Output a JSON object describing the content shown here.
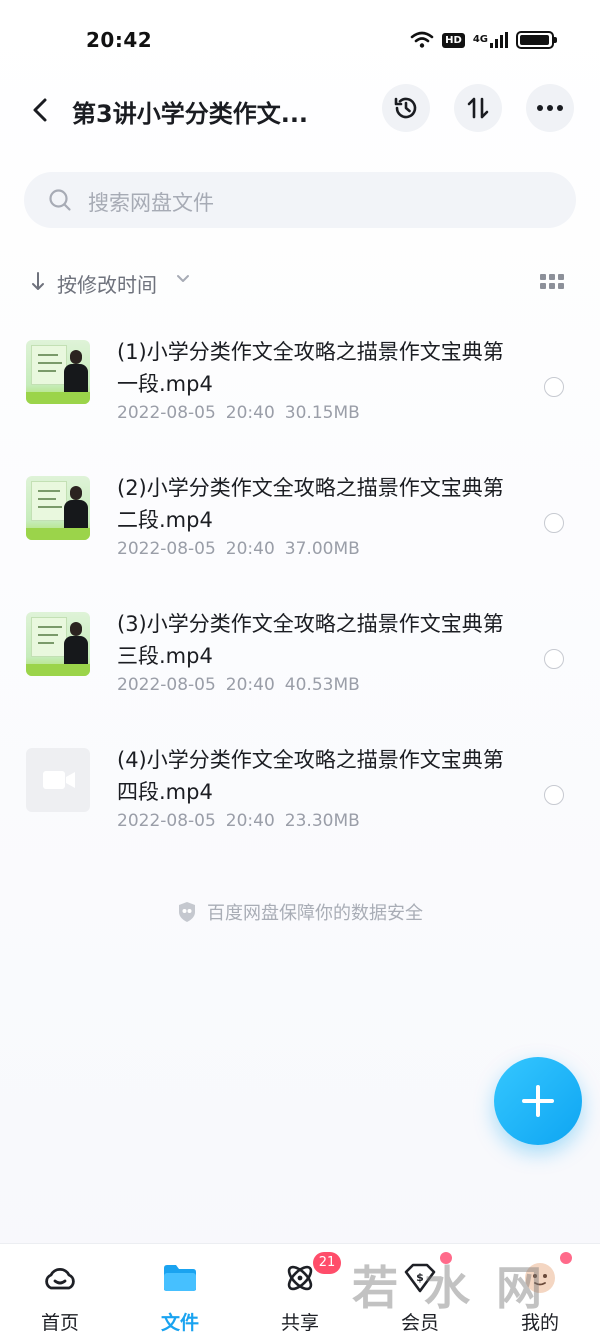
{
  "status_bar": {
    "time": "20:42",
    "hd": "HD",
    "network": "4G",
    "battery_level": 0.95
  },
  "header": {
    "title": "第3讲小学分类作文...",
    "back_icon": "chevron-left-icon",
    "actions": [
      "history-icon",
      "sort-icon",
      "more-icon"
    ]
  },
  "search": {
    "placeholder": "搜索网盘文件"
  },
  "sort": {
    "label": "按修改时间"
  },
  "files": [
    {
      "name": "(1)小学分类作文全攻略之描景作文宝典第一段.mp4",
      "date": "2022-08-05",
      "time": "20:40",
      "size": "30.15MB",
      "thumb": "video-thumbnail"
    },
    {
      "name": "(2)小学分类作文全攻略之描景作文宝典第二段.mp4",
      "date": "2022-08-05",
      "time": "20:40",
      "size": "37.00MB",
      "thumb": "video-thumbnail"
    },
    {
      "name": "(3)小学分类作文全攻略之描景作文宝典第三段.mp4",
      "date": "2022-08-05",
      "time": "20:40",
      "size": "40.53MB",
      "thumb": "video-thumbnail"
    },
    {
      "name": "(4)小学分类作文全攻略之描景作文宝典第四段.mp4",
      "date": "2022-08-05",
      "time": "20:40",
      "size": "23.30MB",
      "thumb": "video-placeholder"
    }
  ],
  "security_note": "百度网盘保障你的数据安全",
  "colors": {
    "accent": "#1aa3f0",
    "badge": "#ff4d6a"
  },
  "tabs": [
    {
      "label": "首页",
      "icon": "home-cloud-icon"
    },
    {
      "label": "文件",
      "icon": "folder-icon",
      "active": true
    },
    {
      "label": "共享",
      "icon": "share-atom-icon",
      "badge": "21"
    },
    {
      "label": "会员",
      "icon": "vip-diamond-icon"
    },
    {
      "label": "我的",
      "icon": "profile-avatar-icon"
    }
  ],
  "watermark": "若水网"
}
